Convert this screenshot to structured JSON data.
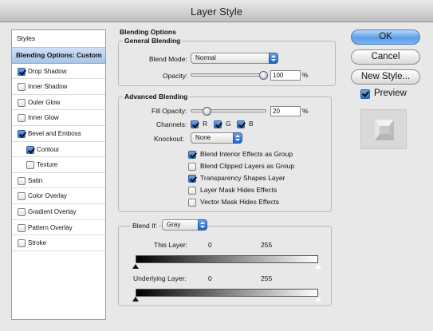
{
  "window": {
    "title": "Layer Style"
  },
  "styles_panel": {
    "header": "Styles",
    "items": [
      {
        "label": "Blending Options: Custom",
        "checked": null,
        "selected": true,
        "sub": false
      },
      {
        "label": "Drop Shadow",
        "checked": true,
        "selected": false,
        "sub": false
      },
      {
        "label": "Inner Shadow",
        "checked": false,
        "selected": false,
        "sub": false
      },
      {
        "label": "Outer Glow",
        "checked": false,
        "selected": false,
        "sub": false
      },
      {
        "label": "Inner Glow",
        "checked": false,
        "selected": false,
        "sub": false
      },
      {
        "label": "Bevel and Emboss",
        "checked": true,
        "selected": false,
        "sub": false
      },
      {
        "label": "Contour",
        "checked": true,
        "selected": false,
        "sub": true
      },
      {
        "label": "Texture",
        "checked": false,
        "selected": false,
        "sub": true
      },
      {
        "label": "Satin",
        "checked": false,
        "selected": false,
        "sub": false
      },
      {
        "label": "Color Overlay",
        "checked": false,
        "selected": false,
        "sub": false
      },
      {
        "label": "Gradient Overlay",
        "checked": false,
        "selected": false,
        "sub": false
      },
      {
        "label": "Pattern Overlay",
        "checked": false,
        "selected": false,
        "sub": false
      },
      {
        "label": "Stroke",
        "checked": false,
        "selected": false,
        "sub": false
      }
    ]
  },
  "blending_options": {
    "title": "Blending Options",
    "general": {
      "title": "General Blending",
      "blend_mode_label": "Blend Mode:",
      "blend_mode_value": "Normal",
      "opacity_label": "Opacity:",
      "opacity_value": "100",
      "opacity_level": 1.0,
      "percent": "%"
    },
    "advanced": {
      "title": "Advanced Blending",
      "fill_opacity_label": "Fill Opacity:",
      "fill_opacity_value": "20",
      "fill_opacity_level": 0.2,
      "percent": "%",
      "channels_label": "Channels:",
      "channel_r": "R",
      "channel_g": "G",
      "channel_b": "B",
      "knockout_label": "Knockout:",
      "knockout_value": "None",
      "options": [
        {
          "label": "Blend Interior Effects as Group",
          "checked": true
        },
        {
          "label": "Blend Clipped Layers as Group",
          "checked": false
        },
        {
          "label": "Transparency Shapes Layer",
          "checked": true
        },
        {
          "label": "Layer Mask Hides Effects",
          "checked": false
        },
        {
          "label": "Vector Mask Hides Effects",
          "checked": false
        }
      ]
    },
    "blend_if": {
      "label": "Blend If:",
      "value": "Gray",
      "this_layer_label": "This Layer:",
      "this_layer_min": "0",
      "this_layer_max": "255",
      "underlying_label": "Underlying Layer:",
      "underlying_min": "0",
      "underlying_max": "255"
    }
  },
  "buttons": {
    "ok": "OK",
    "cancel": "Cancel",
    "new_style": "New Style...",
    "preview_label": "Preview",
    "preview_checked": true
  }
}
